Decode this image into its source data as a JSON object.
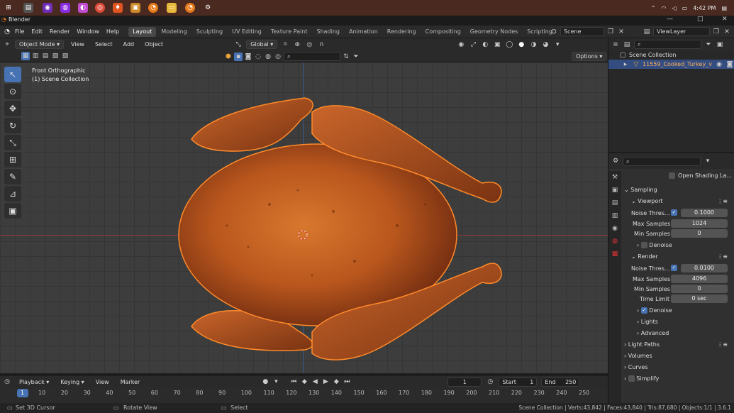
{
  "taskbar": {
    "clock": "4:42 PM",
    "icons": [
      "windows-start-icon",
      "folder-icon",
      "app-icon-2",
      "app-icon-3",
      "chrome-icon",
      "brave-icon",
      "app-icon-6",
      "app-icon-7",
      "blender-icon-1",
      "file-explorer-icon",
      "blender-icon-2",
      "settings-icon"
    ]
  },
  "window": {
    "title": "Blender",
    "minimize": "—",
    "maximize": "□",
    "close": "✕"
  },
  "menu": {
    "items": [
      "File",
      "Edit",
      "Render",
      "Window",
      "Help"
    ]
  },
  "workspaces": [
    "Layout",
    "Modeling",
    "Sculpting",
    "UV Editing",
    "Texture Paint",
    "Shading",
    "Animation",
    "Rendering",
    "Compositing",
    "Geometry Nodes",
    "Scripting"
  ],
  "active_workspace": "Layout",
  "add_workspace": "+",
  "scene": {
    "name": "Scene",
    "view_layer": "ViewLayer"
  },
  "viewport_header": {
    "mode": "Object Mode",
    "menus": [
      "View",
      "Select",
      "Add",
      "Object"
    ],
    "transform_orientation": "Global",
    "options": "Options"
  },
  "viewport": {
    "view_name": "Front Orthographic",
    "collection_label": "(1) Scene Collection"
  },
  "outliner": {
    "collection": "Scene Collection",
    "object": "11559_Cooked_Turkey_v"
  },
  "properties": {
    "open_shading": "Open Shading La...",
    "sampling": "Sampling",
    "viewport": {
      "title": "Viewport",
      "noise_label": "Noise Thres...",
      "noise_value": "0.1000",
      "max_label": "Max Samples",
      "max_value": "1024",
      "min_label": "Min Samples",
      "min_value": "0",
      "denoise": "Denoise"
    },
    "render": {
      "title": "Render",
      "noise_label": "Noise Thres...",
      "noise_value": "0.0100",
      "max_label": "Max Samples",
      "max_value": "4096",
      "min_label": "Min Samples",
      "min_value": "0",
      "time_label": "Time Limit",
      "time_value": "0 sec",
      "denoise": "Denoise",
      "lights": "Lights",
      "advanced": "Advanced"
    },
    "light_paths": "Light Paths",
    "volumes": "Volumes",
    "curves": "Curves",
    "simplify": "Simplify"
  },
  "timeline": {
    "menus": [
      "Playback",
      "Keying",
      "View",
      "Marker"
    ],
    "current_frame": "1",
    "start_label": "Start",
    "start_value": "1",
    "end_label": "End",
    "end_value": "250",
    "ticks": [
      "1",
      "10",
      "20",
      "30",
      "40",
      "50",
      "60",
      "70",
      "80",
      "90",
      "100",
      "110",
      "120",
      "130",
      "140",
      "150",
      "160",
      "170",
      "180",
      "190",
      "200",
      "210",
      "220",
      "230",
      "240",
      "250"
    ]
  },
  "statusbar": {
    "left": "Set 3D Cursor",
    "middle": "Rotate View",
    "right_action": "Select",
    "stats": "Scene Collection | Verts:43,842 | Faces:43,840 | Tris:87,680 | Objects:1/1 | 3.6.1"
  },
  "colors": {
    "accent": "#4772b3",
    "selection": "#ff8a2a",
    "taskbar": "#4a2a20"
  }
}
